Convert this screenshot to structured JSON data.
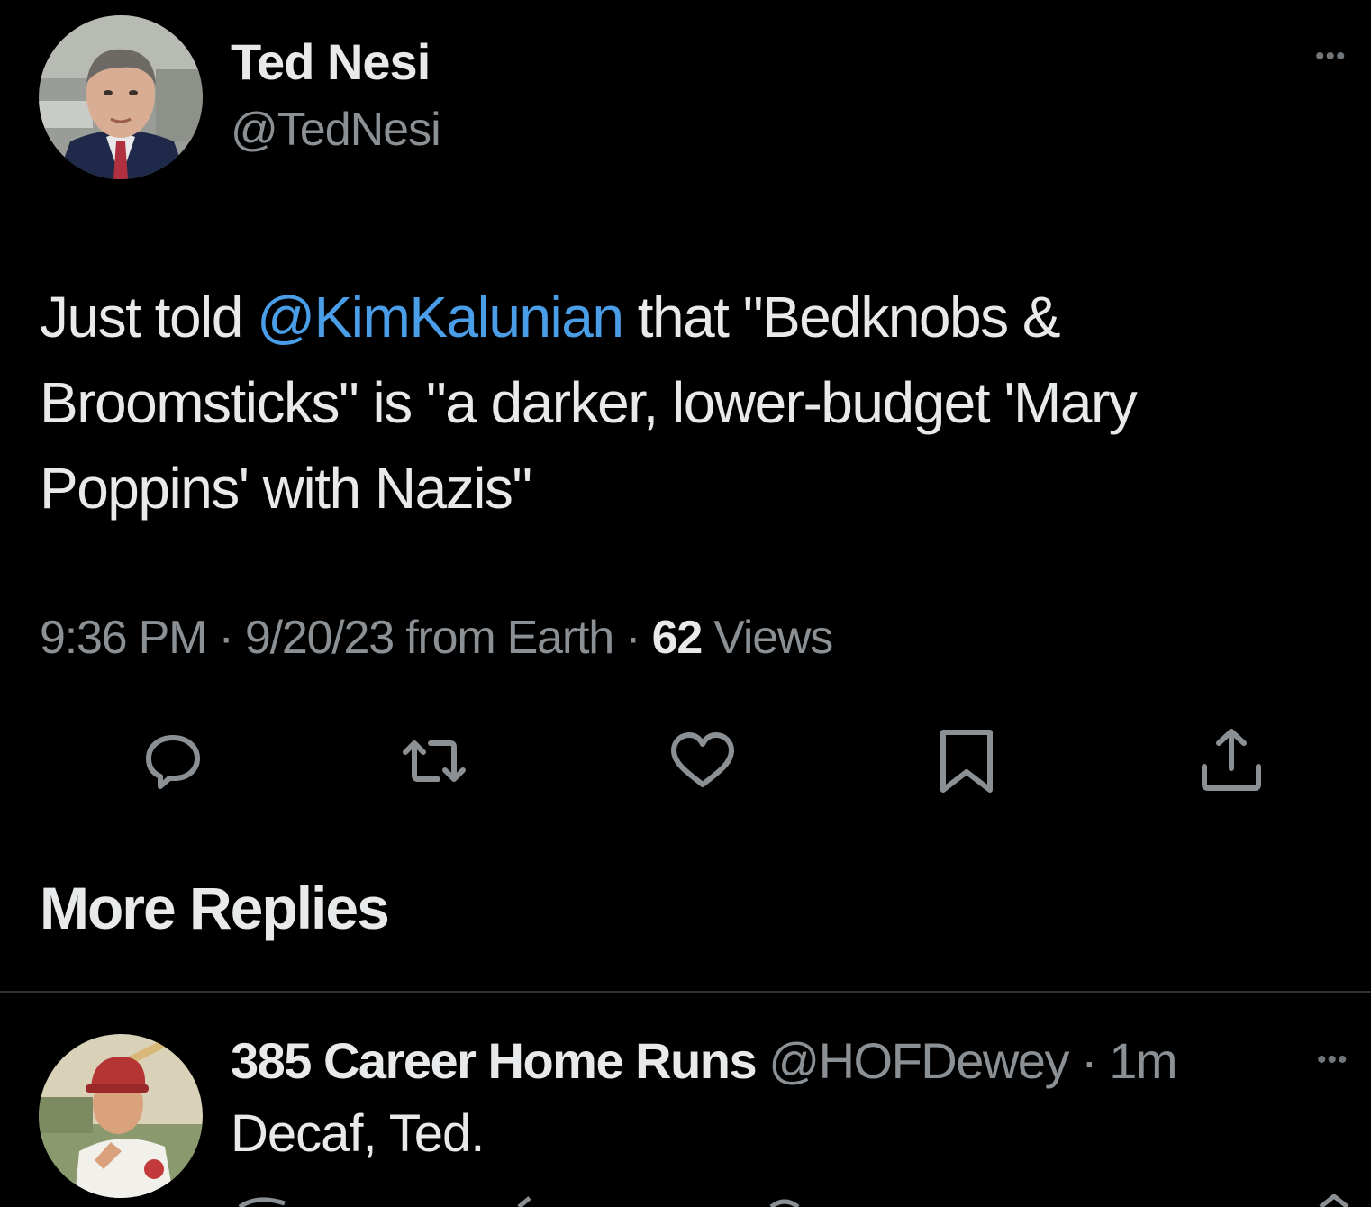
{
  "tweet": {
    "author_name": "Ted Nesi",
    "author_handle": "@TedNesi",
    "more_icon": "ellipsis-icon",
    "more_label": "•••",
    "text_line1_a": "Just told ",
    "mention": "@KimKalunian",
    "text_line1_b": " that \"Bedknobs &",
    "text_line2": "Broomsticks\" is \"a darker, lower-budget 'Mary",
    "text_line3": "Poppins' with Nazis\"",
    "time": "9:36 PM",
    "separator": " · ",
    "date_source": "9/20/23 from Earth",
    "views_count": "62",
    "views_label": " Views",
    "actions": [
      "reply-icon",
      "retweet-icon",
      "like-icon",
      "bookmark-icon",
      "share-icon"
    ]
  },
  "more_replies": {
    "heading": "More Replies"
  },
  "reply": {
    "name": "385 Career Home Runs",
    "handle": " @HOFDewey",
    "separator": " · ",
    "time": "1m",
    "more_label": "•••",
    "text": "Decaf, Ted."
  },
  "colors": {
    "background": "#000000",
    "text_primary": "#e7e9ea",
    "text_secondary": "#8b9095",
    "mention": "#4a9ee8",
    "divider": "#2f3336"
  }
}
